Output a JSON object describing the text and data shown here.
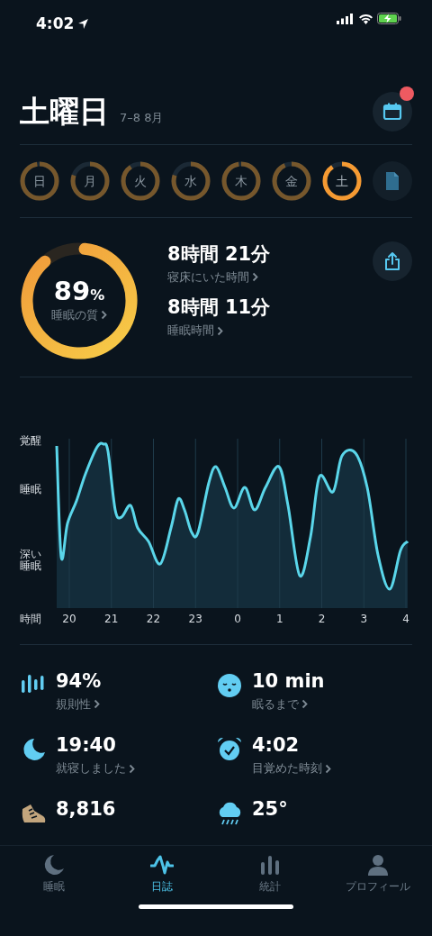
{
  "status_bar": {
    "time": "4:02"
  },
  "header": {
    "title": "土曜日",
    "date_range": "7–8 8月",
    "notification": true
  },
  "days": [
    {
      "label": "日",
      "selected": false
    },
    {
      "label": "月",
      "selected": false
    },
    {
      "label": "火",
      "selected": false
    },
    {
      "label": "水",
      "selected": false
    },
    {
      "label": "木",
      "selected": false
    },
    {
      "label": "金",
      "selected": false
    },
    {
      "label": "土",
      "selected": true
    }
  ],
  "summary": {
    "quality": {
      "value": "89",
      "unit": "%",
      "label": "睡眠の質",
      "level": 0.89
    },
    "metrics": [
      {
        "value": "8時間 21分",
        "label": "寝床にいた時間"
      },
      {
        "value": "8時間 11分",
        "label": "睡眠時間"
      }
    ]
  },
  "chart": {
    "y_labels": [
      "覚醒",
      "睡眠",
      "深い睡眠"
    ],
    "x_title": "時間",
    "x_labels": [
      "20",
      "21",
      "22",
      "23",
      "0",
      "1",
      "2",
      "3",
      "4"
    ]
  },
  "stats": [
    {
      "kind": "bars",
      "value": "94%",
      "label": "規則性"
    },
    {
      "kind": "face",
      "value": "10 min",
      "label": "眠るまで"
    },
    {
      "kind": "moon",
      "value": "19:40",
      "label": "就寝しました"
    },
    {
      "kind": "alarm",
      "value": "4:02",
      "label": "目覚めた時刻"
    },
    {
      "kind": "shoe",
      "value": "8,816"
    },
    {
      "kind": "cloud",
      "value": "25°"
    }
  ],
  "tab_bar": [
    {
      "kind": "moon",
      "label": "睡眠",
      "selected": false
    },
    {
      "kind": "wave",
      "label": "日誌",
      "selected": true
    },
    {
      "kind": "bars",
      "label": "統計",
      "selected": false
    },
    {
      "kind": "person",
      "label": "プロフィール",
      "selected": false
    }
  ]
}
